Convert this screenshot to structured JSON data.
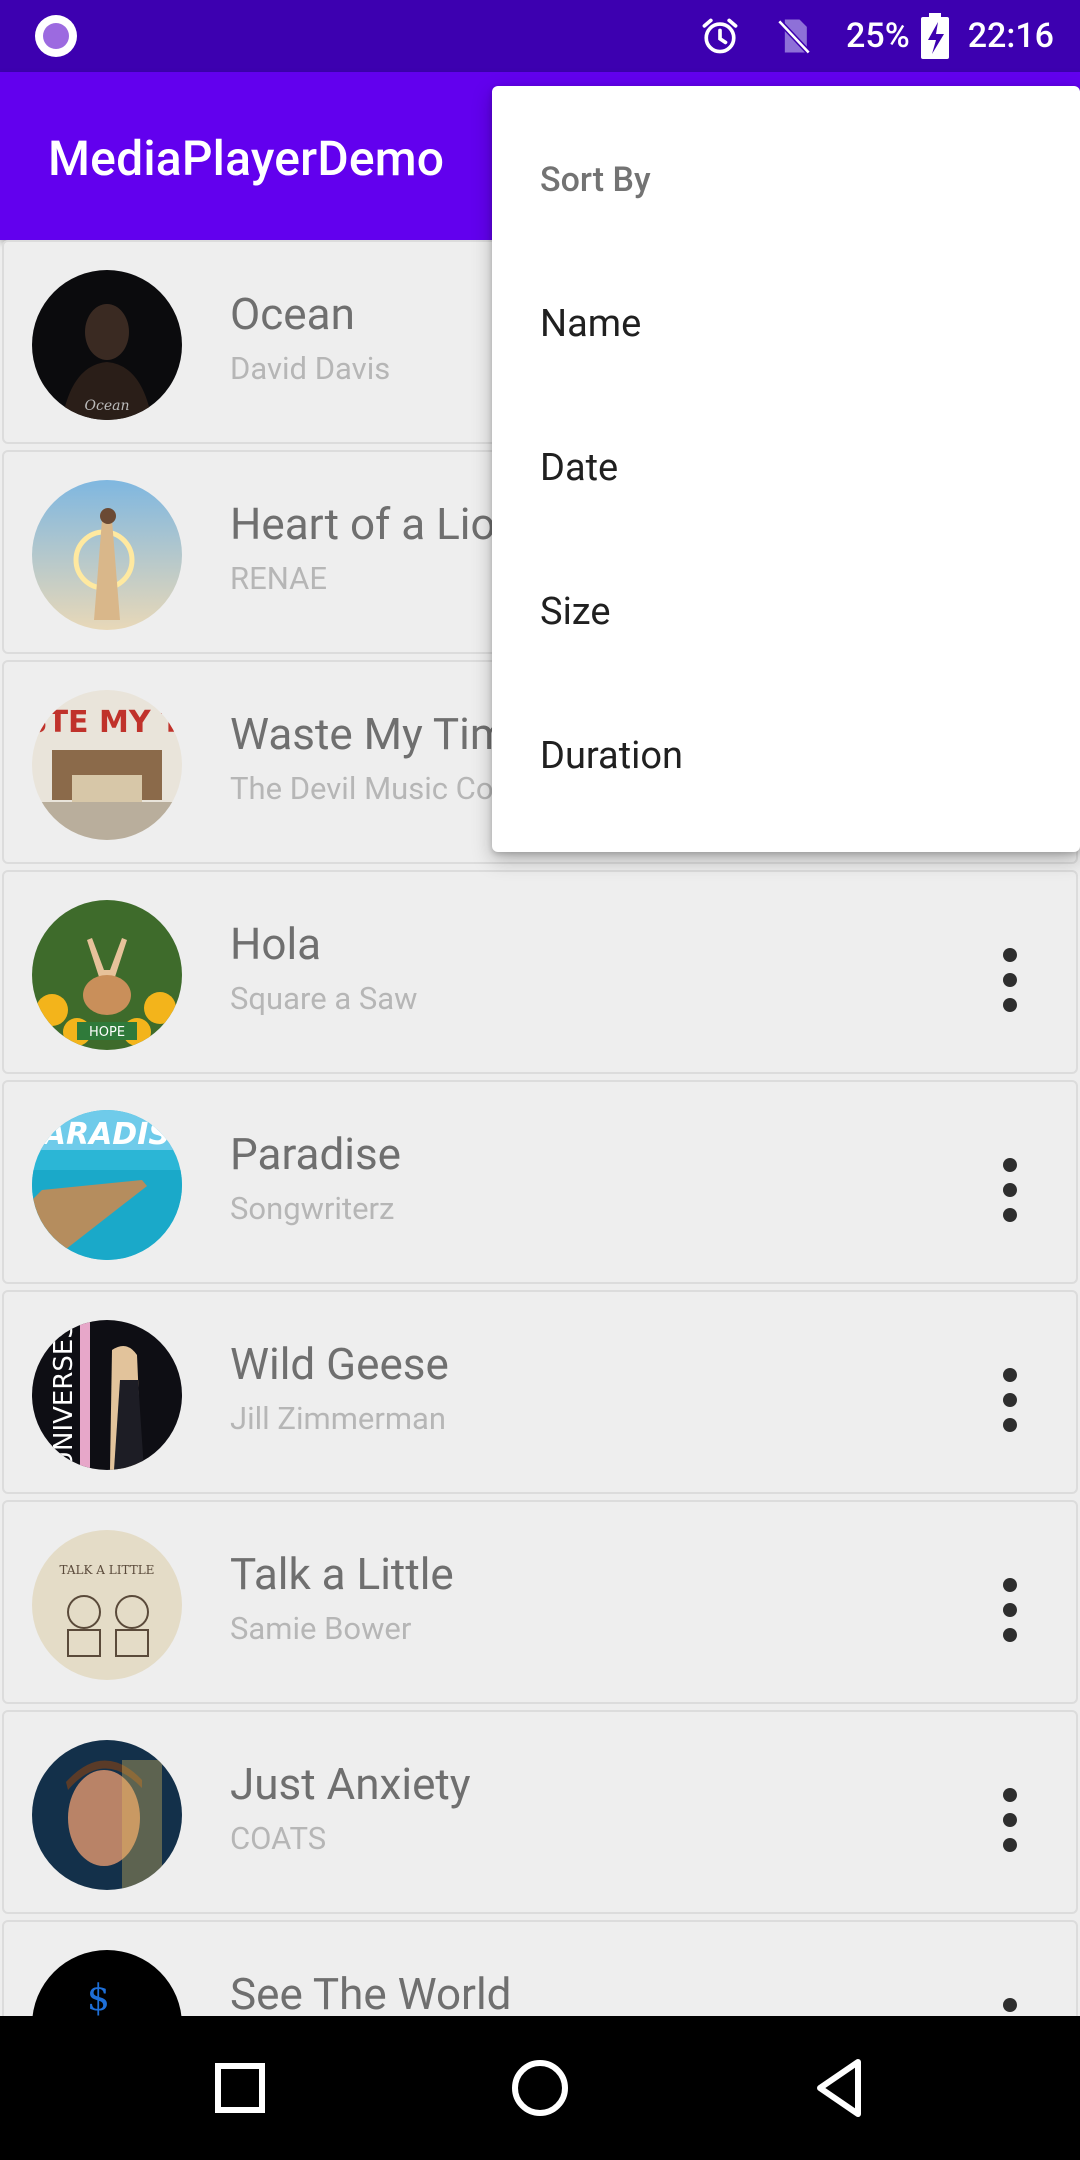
{
  "status_bar": {
    "battery": "25%",
    "time": "22:16",
    "icons": [
      "app-notification-icon",
      "alarm-icon",
      "no-sim-icon",
      "battery-charging-icon"
    ]
  },
  "app_bar": {
    "title": "MediaPlayerDemo"
  },
  "songs": [
    {
      "title": "Ocean",
      "artist": "David Davis"
    },
    {
      "title": "Heart of a Lion",
      "artist": "RENAE"
    },
    {
      "title": "Waste My Time",
      "artist": "The Devil Music Co."
    },
    {
      "title": "Hola",
      "artist": "Square a Saw"
    },
    {
      "title": "Paradise",
      "artist": "Songwriterz"
    },
    {
      "title": "Wild Geese",
      "artist": "Jill Zimmerman"
    },
    {
      "title": "Talk a Little",
      "artist": "Samie Bower"
    },
    {
      "title": "Just Anxiety",
      "artist": "COATS"
    },
    {
      "title": "See The World",
      "artist": ""
    }
  ],
  "sort_menu": {
    "header": "Sort By",
    "items": [
      "Name",
      "Date",
      "Size",
      "Duration"
    ]
  },
  "nav_bar": {
    "icons": [
      "recents-icon",
      "home-icon",
      "back-icon"
    ]
  },
  "colors": {
    "status_bar": "#3D00B0",
    "app_bar": "#6200EE",
    "list_background": "#EEEEEE"
  }
}
